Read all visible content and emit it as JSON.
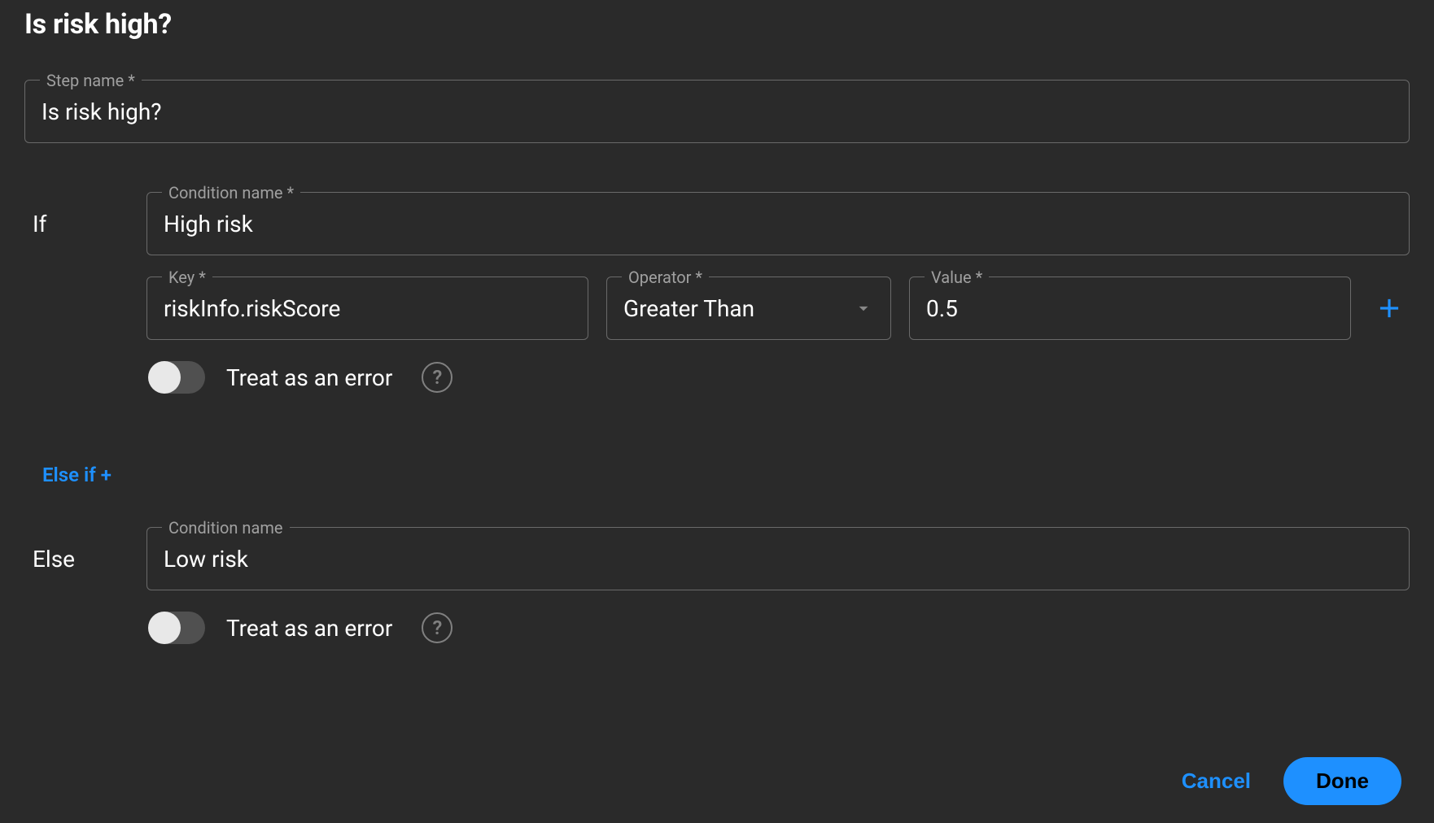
{
  "dialog": {
    "title": "Is risk high?",
    "step_name_label": "Step name *",
    "step_name_value": "Is risk high?"
  },
  "if_branch": {
    "label": "If",
    "condition_name_label": "Condition name *",
    "condition_name_value": "High risk",
    "key_label": "Key *",
    "key_value": "riskInfo.riskScore",
    "operator_label": "Operator *",
    "operator_value": "Greater Than",
    "value_label": "Value *",
    "value_value": "0.5",
    "treat_as_error_label": "Treat as an error"
  },
  "elseif": {
    "link_text": "Else if +"
  },
  "else_branch": {
    "label": "Else",
    "condition_name_label": "Condition name",
    "condition_name_value": "Low risk",
    "treat_as_error_label": "Treat as an error"
  },
  "footer": {
    "cancel": "Cancel",
    "done": "Done"
  }
}
